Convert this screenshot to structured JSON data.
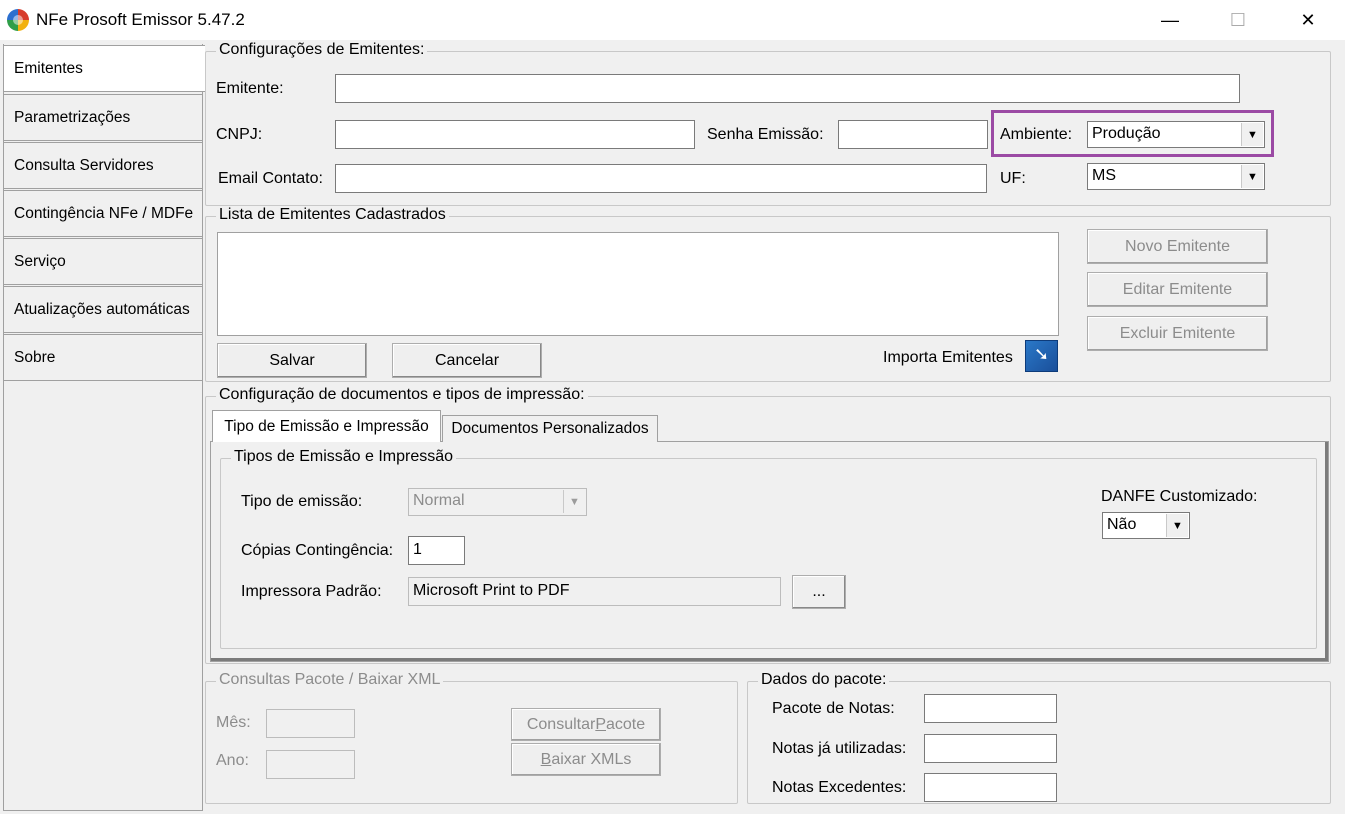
{
  "window": {
    "title": "NFe Prosoft Emissor 5.47.2",
    "minimize": "—",
    "maximize": "☐",
    "close": "✕"
  },
  "sidebar": {
    "items": [
      {
        "label": "Emitentes"
      },
      {
        "label": "Parametrizações"
      },
      {
        "label": "Consulta Servidores"
      },
      {
        "label": "Contingência NFe / MDFe"
      },
      {
        "label": "Serviço"
      },
      {
        "label": "Atualizações automáticas"
      },
      {
        "label": "Sobre"
      }
    ]
  },
  "config_emitentes": {
    "legend": "Configurações de Emitentes:",
    "emitente_label": "Emitente:",
    "emitente_value": "",
    "cnpj_label": "CNPJ:",
    "cnpj_value": "",
    "senha_label": "Senha Emissão:",
    "senha_value": "",
    "ambiente_label": "Ambiente:",
    "ambiente_value": "Produção",
    "email_label": "Email Contato:",
    "email_value": "",
    "uf_label": "UF:",
    "uf_value": "MS",
    "highlight_color": "#9b4aa4"
  },
  "lista_emitentes": {
    "legend": "Lista de Emitentes Cadastrados",
    "novo": "Novo Emitente",
    "editar": "Editar Emitente",
    "excluir": "Excluir Emitente",
    "salvar": "Salvar",
    "cancelar": "Cancelar",
    "importa": "Importa Emitentes"
  },
  "config_documentos": {
    "legend": "Configuração de documentos  e tipos de impressão:",
    "tabs": [
      {
        "label": "Tipo de Emissão e Impressão"
      },
      {
        "label": "Documentos Personalizados"
      }
    ],
    "inner_legend": "Tipos de Emissão e Impressão",
    "tipo_emissao_label": "Tipo de emissão:",
    "tipo_emissao_value": "Normal",
    "copias_label": "Cópias Contingência:",
    "copias_value": "1",
    "impressora_label": "Impressora Padrão:",
    "impressora_value": "Microsoft Print to PDF",
    "browse_label": "...",
    "danfe_label": "DANFE Customizado:",
    "danfe_value": "Não"
  },
  "consultas_pacote": {
    "legend": "Consultas Pacote / Baixar XML",
    "mes_label": "Mês:",
    "ano_label": "Ano:",
    "consultar_pre": "Consultar ",
    "consultar_u": "P",
    "consultar_post": "acote",
    "baixar_u": "B",
    "baixar_post": "aixar XMLs"
  },
  "dados_pacote": {
    "legend": "Dados do pacote:",
    "pacote_label": "Pacote de Notas:",
    "utilizadas_label": "Notas já utilizadas:",
    "excedentes_label": "Notas Excedentes:"
  }
}
